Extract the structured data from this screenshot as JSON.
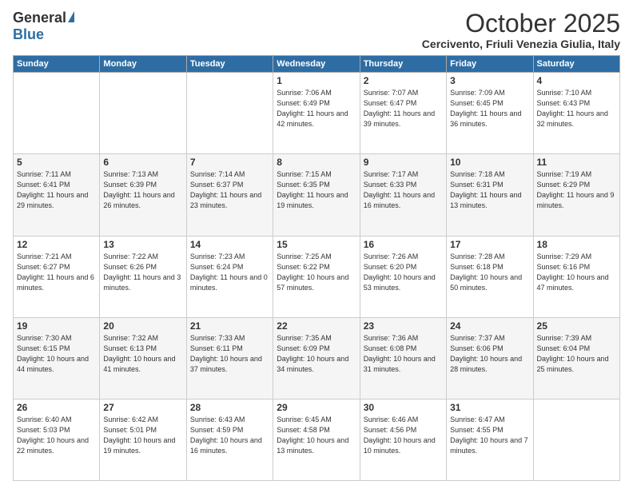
{
  "logo": {
    "general": "General",
    "blue": "Blue"
  },
  "title": "October 2025",
  "location": "Cercivento, Friuli Venezia Giulia, Italy",
  "days_of_week": [
    "Sunday",
    "Monday",
    "Tuesday",
    "Wednesday",
    "Thursday",
    "Friday",
    "Saturday"
  ],
  "weeks": [
    [
      {
        "day": "",
        "sunrise": "",
        "sunset": "",
        "daylight": ""
      },
      {
        "day": "",
        "sunrise": "",
        "sunset": "",
        "daylight": ""
      },
      {
        "day": "",
        "sunrise": "",
        "sunset": "",
        "daylight": ""
      },
      {
        "day": "1",
        "sunrise": "Sunrise: 7:06 AM",
        "sunset": "Sunset: 6:49 PM",
        "daylight": "Daylight: 11 hours and 42 minutes."
      },
      {
        "day": "2",
        "sunrise": "Sunrise: 7:07 AM",
        "sunset": "Sunset: 6:47 PM",
        "daylight": "Daylight: 11 hours and 39 minutes."
      },
      {
        "day": "3",
        "sunrise": "Sunrise: 7:09 AM",
        "sunset": "Sunset: 6:45 PM",
        "daylight": "Daylight: 11 hours and 36 minutes."
      },
      {
        "day": "4",
        "sunrise": "Sunrise: 7:10 AM",
        "sunset": "Sunset: 6:43 PM",
        "daylight": "Daylight: 11 hours and 32 minutes."
      }
    ],
    [
      {
        "day": "5",
        "sunrise": "Sunrise: 7:11 AM",
        "sunset": "Sunset: 6:41 PM",
        "daylight": "Daylight: 11 hours and 29 minutes."
      },
      {
        "day": "6",
        "sunrise": "Sunrise: 7:13 AM",
        "sunset": "Sunset: 6:39 PM",
        "daylight": "Daylight: 11 hours and 26 minutes."
      },
      {
        "day": "7",
        "sunrise": "Sunrise: 7:14 AM",
        "sunset": "Sunset: 6:37 PM",
        "daylight": "Daylight: 11 hours and 23 minutes."
      },
      {
        "day": "8",
        "sunrise": "Sunrise: 7:15 AM",
        "sunset": "Sunset: 6:35 PM",
        "daylight": "Daylight: 11 hours and 19 minutes."
      },
      {
        "day": "9",
        "sunrise": "Sunrise: 7:17 AM",
        "sunset": "Sunset: 6:33 PM",
        "daylight": "Daylight: 11 hours and 16 minutes."
      },
      {
        "day": "10",
        "sunrise": "Sunrise: 7:18 AM",
        "sunset": "Sunset: 6:31 PM",
        "daylight": "Daylight: 11 hours and 13 minutes."
      },
      {
        "day": "11",
        "sunrise": "Sunrise: 7:19 AM",
        "sunset": "Sunset: 6:29 PM",
        "daylight": "Daylight: 11 hours and 9 minutes."
      }
    ],
    [
      {
        "day": "12",
        "sunrise": "Sunrise: 7:21 AM",
        "sunset": "Sunset: 6:27 PM",
        "daylight": "Daylight: 11 hours and 6 minutes."
      },
      {
        "day": "13",
        "sunrise": "Sunrise: 7:22 AM",
        "sunset": "Sunset: 6:26 PM",
        "daylight": "Daylight: 11 hours and 3 minutes."
      },
      {
        "day": "14",
        "sunrise": "Sunrise: 7:23 AM",
        "sunset": "Sunset: 6:24 PM",
        "daylight": "Daylight: 11 hours and 0 minutes."
      },
      {
        "day": "15",
        "sunrise": "Sunrise: 7:25 AM",
        "sunset": "Sunset: 6:22 PM",
        "daylight": "Daylight: 10 hours and 57 minutes."
      },
      {
        "day": "16",
        "sunrise": "Sunrise: 7:26 AM",
        "sunset": "Sunset: 6:20 PM",
        "daylight": "Daylight: 10 hours and 53 minutes."
      },
      {
        "day": "17",
        "sunrise": "Sunrise: 7:28 AM",
        "sunset": "Sunset: 6:18 PM",
        "daylight": "Daylight: 10 hours and 50 minutes."
      },
      {
        "day": "18",
        "sunrise": "Sunrise: 7:29 AM",
        "sunset": "Sunset: 6:16 PM",
        "daylight": "Daylight: 10 hours and 47 minutes."
      }
    ],
    [
      {
        "day": "19",
        "sunrise": "Sunrise: 7:30 AM",
        "sunset": "Sunset: 6:15 PM",
        "daylight": "Daylight: 10 hours and 44 minutes."
      },
      {
        "day": "20",
        "sunrise": "Sunrise: 7:32 AM",
        "sunset": "Sunset: 6:13 PM",
        "daylight": "Daylight: 10 hours and 41 minutes."
      },
      {
        "day": "21",
        "sunrise": "Sunrise: 7:33 AM",
        "sunset": "Sunset: 6:11 PM",
        "daylight": "Daylight: 10 hours and 37 minutes."
      },
      {
        "day": "22",
        "sunrise": "Sunrise: 7:35 AM",
        "sunset": "Sunset: 6:09 PM",
        "daylight": "Daylight: 10 hours and 34 minutes."
      },
      {
        "day": "23",
        "sunrise": "Sunrise: 7:36 AM",
        "sunset": "Sunset: 6:08 PM",
        "daylight": "Daylight: 10 hours and 31 minutes."
      },
      {
        "day": "24",
        "sunrise": "Sunrise: 7:37 AM",
        "sunset": "Sunset: 6:06 PM",
        "daylight": "Daylight: 10 hours and 28 minutes."
      },
      {
        "day": "25",
        "sunrise": "Sunrise: 7:39 AM",
        "sunset": "Sunset: 6:04 PM",
        "daylight": "Daylight: 10 hours and 25 minutes."
      }
    ],
    [
      {
        "day": "26",
        "sunrise": "Sunrise: 6:40 AM",
        "sunset": "Sunset: 5:03 PM",
        "daylight": "Daylight: 10 hours and 22 minutes."
      },
      {
        "day": "27",
        "sunrise": "Sunrise: 6:42 AM",
        "sunset": "Sunset: 5:01 PM",
        "daylight": "Daylight: 10 hours and 19 minutes."
      },
      {
        "day": "28",
        "sunrise": "Sunrise: 6:43 AM",
        "sunset": "Sunset: 4:59 PM",
        "daylight": "Daylight: 10 hours and 16 minutes."
      },
      {
        "day": "29",
        "sunrise": "Sunrise: 6:45 AM",
        "sunset": "Sunset: 4:58 PM",
        "daylight": "Daylight: 10 hours and 13 minutes."
      },
      {
        "day": "30",
        "sunrise": "Sunrise: 6:46 AM",
        "sunset": "Sunset: 4:56 PM",
        "daylight": "Daylight: 10 hours and 10 minutes."
      },
      {
        "day": "31",
        "sunrise": "Sunrise: 6:47 AM",
        "sunset": "Sunset: 4:55 PM",
        "daylight": "Daylight: 10 hours and 7 minutes."
      },
      {
        "day": "",
        "sunrise": "",
        "sunset": "",
        "daylight": ""
      }
    ]
  ]
}
